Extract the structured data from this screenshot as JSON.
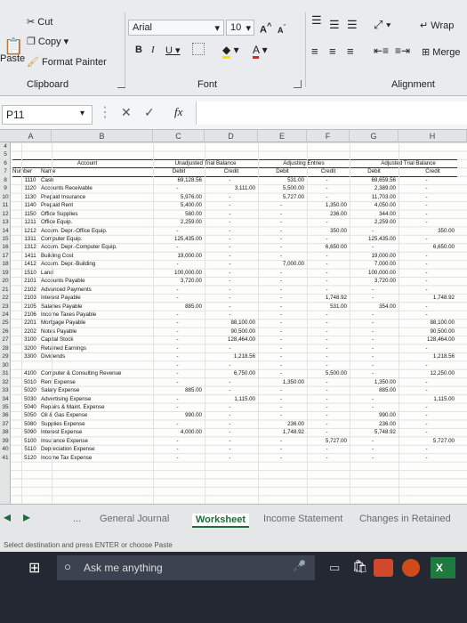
{
  "ribbon": {
    "clipboard": {
      "cut": "Cut",
      "copy": "Copy",
      "paste": "Paste",
      "format_painter": "Format Painter",
      "label": "Clipboard"
    },
    "font": {
      "name": "Arial",
      "size": "10",
      "bold": "B",
      "italic": "I",
      "underline": "U",
      "grow": "A",
      "shrink": "A",
      "font_color": "A",
      "label": "Font"
    },
    "alignment": {
      "wrap": "Wrap",
      "merge": "Merge",
      "label": "Alignment"
    }
  },
  "formula_bar": {
    "cell_ref": "P11",
    "fx": "fx"
  },
  "columns": [
    "A",
    "B",
    "C",
    "D",
    "E",
    "F",
    "G",
    "H"
  ],
  "rows": [
    "4",
    "5",
    "6",
    "7",
    "8",
    "9",
    "10",
    "11",
    "12",
    "13",
    "14",
    "15",
    "16",
    "17",
    "18",
    "19",
    "20",
    "21",
    "22",
    "23",
    "24",
    "25",
    "26",
    "27",
    "28",
    "29",
    "30",
    "31",
    "32",
    "33",
    "34",
    "35",
    "36",
    "37",
    "38",
    "39",
    "40",
    "41"
  ],
  "table": {
    "header_row1": {
      "account": "Account",
      "unadj": "Unadjusted Trial Balance",
      "adj": "Adjusting Entries",
      "adjtb": "Adjusted Trial Balance"
    },
    "header_row2": {
      "number": "Number",
      "name": "Name",
      "debit": "Debit",
      "credit": "Credit"
    },
    "rows": [
      {
        "num": "1110",
        "name": "Cash",
        "c": "69,128.56",
        "d": "",
        "e": "531.00",
        "f": "",
        "g": "69,659.56",
        "h": ""
      },
      {
        "num": "1120",
        "name": "Accounts Receivable",
        "c": "",
        "d": "3,111.00",
        "e": "5,500.00",
        "f": "",
        "g": "2,389.00",
        "h": ""
      },
      {
        "num": "1130",
        "name": "Prepaid Insurance",
        "c": "5,976.00",
        "d": "",
        "e": "5,727.00",
        "f": "",
        "g": "11,703.00",
        "h": ""
      },
      {
        "num": "1140",
        "name": "Prepaid Rent",
        "c": "5,400.00",
        "d": "",
        "e": "",
        "f": "1,350.00",
        "g": "4,050.00",
        "h": ""
      },
      {
        "num": "1150",
        "name": "Office Supplies",
        "c": "580.00",
        "d": "",
        "e": "",
        "f": "236.00",
        "g": "344.00",
        "h": ""
      },
      {
        "num": "1211",
        "name": "Office Equip.",
        "c": "2,259.00",
        "d": "",
        "e": "",
        "f": "",
        "g": "2,259.00",
        "h": ""
      },
      {
        "num": "1212",
        "name": "Accum. Depr.-Office Equip.",
        "c": "",
        "d": "",
        "e": "",
        "f": "350.00",
        "g": "",
        "h": "350.00"
      },
      {
        "num": "1311",
        "name": "Computer Equip.",
        "c": "125,435.00",
        "d": "",
        "e": "",
        "f": "",
        "g": "125,435.00",
        "h": ""
      },
      {
        "num": "1312",
        "name": "Accum. Depr.-Computer Equip.",
        "c": "",
        "d": "",
        "e": "",
        "f": "6,650.00",
        "g": "",
        "h": "6,650.00"
      },
      {
        "num": "1411",
        "name": "Building Cost",
        "c": "19,000.00",
        "d": "",
        "e": "",
        "f": "",
        "g": "19,000.00",
        "h": ""
      },
      {
        "num": "1412",
        "name": "Accum. Depr.-Building",
        "c": "",
        "d": "",
        "e": "7,000.00",
        "f": "",
        "g": "7,000.00",
        "h": ""
      },
      {
        "num": "1510",
        "name": "Land",
        "c": "100,000.00",
        "d": "",
        "e": "",
        "f": "",
        "g": "100,000.00",
        "h": ""
      },
      {
        "num": "2101",
        "name": "Accounts Payable",
        "c": "3,720.00",
        "d": "",
        "e": "",
        "f": "",
        "g": "3,720.00",
        "h": ""
      },
      {
        "num": "2102",
        "name": "Advanced Payments",
        "c": "",
        "d": "",
        "e": "",
        "f": "",
        "g": "",
        "h": ""
      },
      {
        "num": "2103",
        "name": "Interest Payable",
        "c": "",
        "d": "",
        "e": "",
        "f": "1,748.92",
        "g": "",
        "h": "1,748.92"
      },
      {
        "num": "2105",
        "name": "Salaries Payable",
        "c": "885.00",
        "d": "",
        "e": "",
        "f": "531.00",
        "g": "354.00",
        "h": ""
      },
      {
        "num": "2106",
        "name": "Income Taxes Payable",
        "c": "",
        "d": "",
        "e": "",
        "f": "",
        "g": "",
        "h": ""
      },
      {
        "num": "2201",
        "name": "Mortgage Payable",
        "c": "",
        "d": "88,100.00",
        "e": "",
        "f": "",
        "g": "",
        "h": "88,100.00"
      },
      {
        "num": "2202",
        "name": "Notes Payable",
        "c": "",
        "d": "90,500.00",
        "e": "",
        "f": "",
        "g": "",
        "h": "90,500.00"
      },
      {
        "num": "3100",
        "name": "Capital Stock",
        "c": "",
        "d": "128,464.00",
        "e": "",
        "f": "",
        "g": "",
        "h": "128,464.00"
      },
      {
        "num": "3200",
        "name": "Retained Earnings",
        "c": "",
        "d": "",
        "e": "",
        "f": "",
        "g": "",
        "h": ""
      },
      {
        "num": "3300",
        "name": "Dividends",
        "c": "",
        "d": "1,218.56",
        "e": "",
        "f": "",
        "g": "",
        "h": "1,218.56"
      },
      {
        "num": "",
        "name": "",
        "c": "",
        "d": "",
        "e": "",
        "f": "",
        "g": "",
        "h": ""
      },
      {
        "num": "4100",
        "name": "Computer & Consulting Revenue",
        "c": "",
        "d": "6,750.00",
        "e": "",
        "f": "5,500.00",
        "g": "",
        "h": "12,250.00"
      },
      {
        "num": "5010",
        "name": "Rent Expense",
        "c": "",
        "d": "",
        "e": "1,350.00",
        "f": "",
        "g": "1,350.00",
        "h": ""
      },
      {
        "num": "5020",
        "name": "Salary Expense",
        "c": "885.00",
        "d": "",
        "e": "",
        "f": "",
        "g": "885.00",
        "h": ""
      },
      {
        "num": "5030",
        "name": "Advertising Expense",
        "c": "",
        "d": "1,115.00",
        "e": "",
        "f": "",
        "g": "",
        "h": "1,115.00"
      },
      {
        "num": "5040",
        "name": "Repairs & Maint. Expense",
        "c": "",
        "d": "",
        "e": "",
        "f": "",
        "g": "",
        "h": ""
      },
      {
        "num": "5050",
        "name": "Oil & Gas Expense",
        "c": "990.00",
        "d": "",
        "e": "",
        "f": "",
        "g": "990.00",
        "h": ""
      },
      {
        "num": "5080",
        "name": "Supplies Expense",
        "c": "",
        "d": "",
        "e": "236.00",
        "f": "",
        "g": "236.00",
        "h": ""
      },
      {
        "num": "5090",
        "name": "Interest Expense",
        "c": "4,000.00",
        "d": "",
        "e": "1,748.92",
        "f": "",
        "g": "5,748.92",
        "h": ""
      },
      {
        "num": "5100",
        "name": "Insurance Expense",
        "c": "",
        "d": "",
        "e": "",
        "f": "5,727.00",
        "g": "",
        "h": "5,727.00"
      },
      {
        "num": "5110",
        "name": "Depreciation Expense",
        "c": "",
        "d": "",
        "e": "",
        "f": "",
        "g": "",
        "h": ""
      },
      {
        "num": "5120",
        "name": "Income Tax Expense",
        "c": "",
        "d": "",
        "e": "",
        "f": "",
        "g": "",
        "h": ""
      }
    ]
  },
  "tabs": [
    {
      "label": "...",
      "active": false
    },
    {
      "label": "General Journal",
      "active": false
    },
    {
      "label": "Worksheet",
      "active": true
    },
    {
      "label": "Income Statement",
      "active": false
    },
    {
      "label": "Changes in Retained",
      "active": false
    }
  ],
  "status": {
    "text": "Select destination and press ENTER or choose Paste"
  },
  "taskbar": {
    "search_placeholder": "Ask me anything"
  },
  "colors": {
    "excel_green": "#1f6b3a",
    "taskbar": "#232833",
    "sheet_bg": "#fdfdfc"
  }
}
